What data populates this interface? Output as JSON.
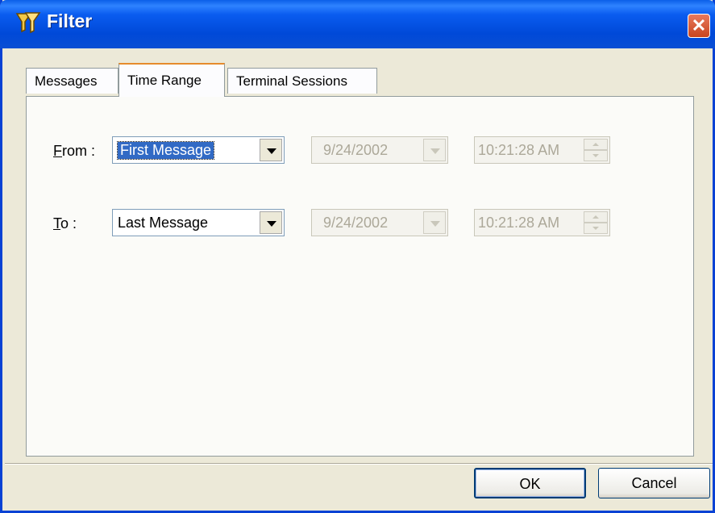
{
  "window": {
    "title": "Filter",
    "close_label": "✕"
  },
  "tabs": [
    {
      "label": "Messages",
      "active": false
    },
    {
      "label": "Time Range",
      "active": true
    },
    {
      "label": "Terminal Sessions",
      "active": false
    }
  ],
  "from": {
    "label_key": "F",
    "label_rest": "rom :",
    "combo_value": "First Message",
    "date_value": "9/24/2002",
    "time_value": "10:21:28 AM"
  },
  "to": {
    "label_key": "T",
    "label_rest": "o :",
    "combo_value": "Last Message",
    "date_value": "9/24/2002",
    "time_value": "10:21:28 AM"
  },
  "buttons": {
    "ok": "OK",
    "cancel": "Cancel"
  },
  "colors": {
    "titlebar": "#0a5cf0",
    "active_tab_accent": "#e68b2c",
    "selection": "#316ac5"
  }
}
